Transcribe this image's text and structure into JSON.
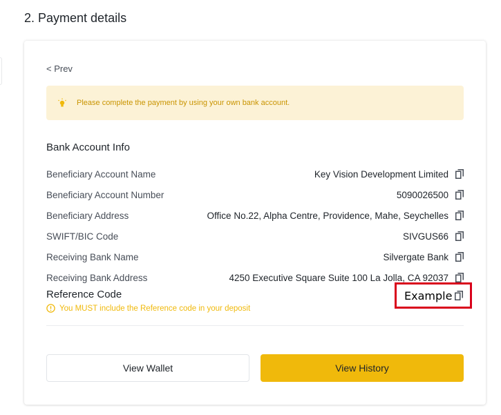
{
  "section": {
    "title": "2. Payment details"
  },
  "nav": {
    "prev_label": "< Prev"
  },
  "notice": {
    "message": "Please complete the payment by using your own bank account."
  },
  "bank": {
    "title": "Bank Account Info",
    "rows": [
      {
        "label": "Beneficiary Account Name",
        "value": "Key Vision Development Limited"
      },
      {
        "label": "Beneficiary Account Number",
        "value": "5090026500"
      },
      {
        "label": "Beneficiary Address",
        "value": "Office No.22, Alpha Centre, Providence, Mahe, Seychelles"
      },
      {
        "label": "SWIFT/BIC Code",
        "value": "SIVGUS66"
      },
      {
        "label": "Receiving Bank Name",
        "value": "Silvergate Bank"
      },
      {
        "label": "Receiving Bank Address",
        "value": "4250 Executive Square Suite 100 La Jolla, CA 92037"
      }
    ]
  },
  "reference": {
    "label": "Reference Code",
    "value": "Example",
    "warning": "You MUST include the Reference code in your deposit"
  },
  "actions": {
    "wallet_label": "View Wallet",
    "history_label": "View History"
  },
  "icons": {
    "copy": "copy-icon",
    "bulb": "lightbulb-icon",
    "warning": "info-circle-icon"
  },
  "colors": {
    "accent": "#f0b90b",
    "notice_bg": "#fcf2d6",
    "notice_text": "#c99400",
    "highlight": "#d9001b"
  }
}
